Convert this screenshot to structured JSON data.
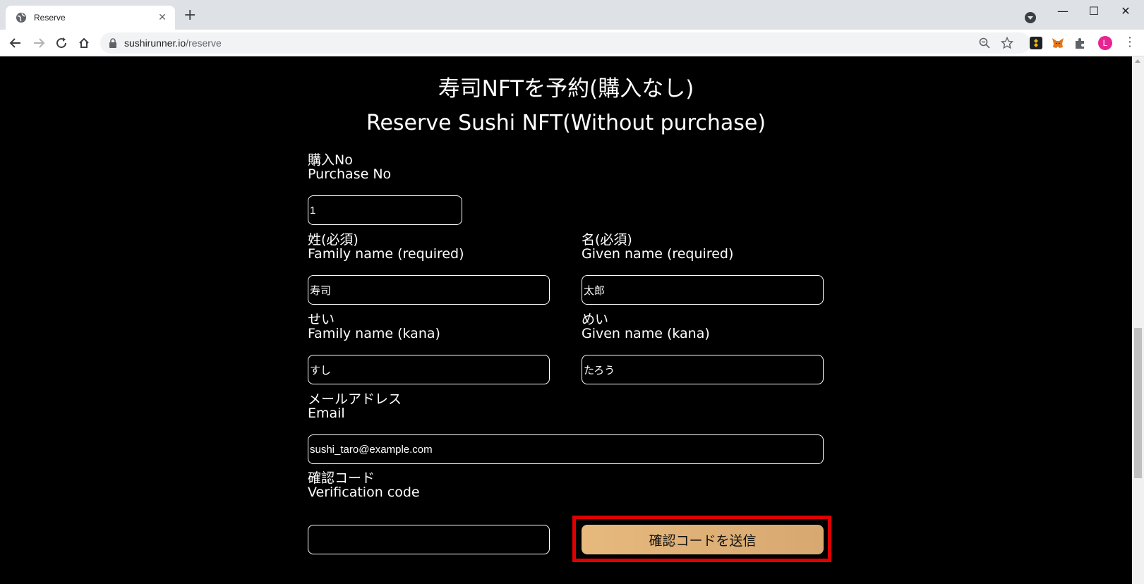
{
  "browser": {
    "tab_title": "Reserve",
    "url_host": "sushirunner.io",
    "url_path": "/reserve",
    "avatar_letter": "L"
  },
  "page": {
    "heading_ja": "寿司NFTを予約(購入なし)",
    "heading_en": "Reserve Sushi NFT(Without purchase)",
    "purchase_no": {
      "label_ja": "購入No",
      "label_en": "Purchase No",
      "value": "1"
    },
    "family_name": {
      "label_ja": "姓(必須)",
      "label_en": "Family name (required)",
      "value": "寿司"
    },
    "given_name": {
      "label_ja": "名(必須)",
      "label_en": "Given name (required)",
      "value": "太郎"
    },
    "family_kana": {
      "label_ja": "せい",
      "label_en": "Family name (kana)",
      "value": "すし"
    },
    "given_kana": {
      "label_ja": "めい",
      "label_en": "Given name (kana)",
      "value": "たろう"
    },
    "email": {
      "label_ja": "メールアドレス",
      "label_en": "Email",
      "value": "sushi_taro@example.com"
    },
    "verification": {
      "label_ja": "確認コード",
      "label_en": "Verification code",
      "value": ""
    },
    "send_code_button": "確認コードを送信"
  },
  "colors": {
    "button_gradient_start": "#e6b97d",
    "button_gradient_end": "#d7a870",
    "highlight": "#e00000"
  }
}
